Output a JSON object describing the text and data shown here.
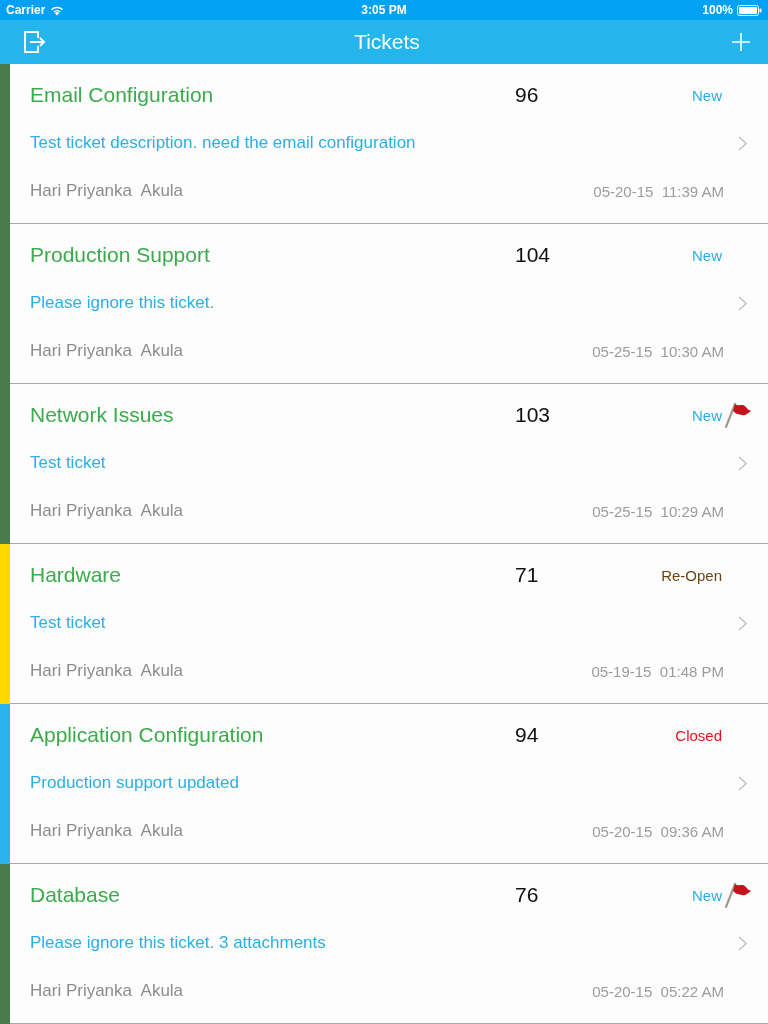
{
  "status_bar": {
    "carrier": "Carrier",
    "time": "3:05 PM",
    "battery": "100%"
  },
  "nav_bar": {
    "title": "Tickets"
  },
  "tickets": [
    {
      "title": "Email Configuration",
      "number": "96",
      "status": {
        "label": "New",
        "color": "#29aee4"
      },
      "flagged": false,
      "description": "Test ticket description. need the email configuration",
      "owner": "Hari Priyanka  Akula",
      "date": "05-20-15  11:39 AM",
      "color": "#487a4b"
    },
    {
      "title": "Production Support",
      "number": "104",
      "status": {
        "label": "New",
        "color": "#29aee4"
      },
      "flagged": false,
      "description": "Please ignore this ticket.",
      "owner": "Hari Priyanka  Akula",
      "date": "05-25-15  10:30 AM",
      "color": "#487a4b"
    },
    {
      "title": "Network Issues",
      "number": "103",
      "status": {
        "label": "New",
        "color": "#29aee4"
      },
      "flagged": true,
      "description": "Test ticket",
      "owner": "Hari Priyanka  Akula",
      "date": "05-25-15  10:29 AM",
      "color": "#487a4b"
    },
    {
      "title": "Hardware",
      "number": "71",
      "status": {
        "label": "Re-Open",
        "color": "#6b4212"
      },
      "flagged": false,
      "description": "Test ticket",
      "owner": "Hari Priyanka  Akula",
      "date": "05-19-15  01:48 PM",
      "color": "#ffd800"
    },
    {
      "title": "Application Configuration",
      "number": "94",
      "status": {
        "label": "Closed",
        "color": "#e3131b"
      },
      "flagged": false,
      "description": "Production support updated",
      "owner": "Hari Priyanka  Akula",
      "date": "05-20-15  09:36 AM",
      "color": "#2bb3ee"
    },
    {
      "title": "Database",
      "number": "76",
      "status": {
        "label": "New",
        "color": "#29aee4"
      },
      "flagged": true,
      "description": "Please ignore this ticket. 3 attachments",
      "owner": "Hari Priyanka  Akula",
      "date": "05-20-15  05:22 AM",
      "color": "#487a4b"
    }
  ]
}
